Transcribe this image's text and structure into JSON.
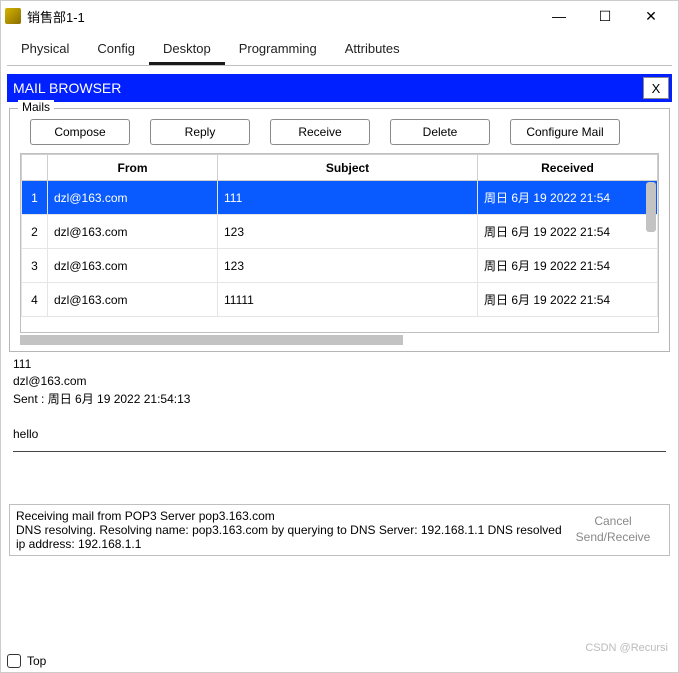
{
  "window": {
    "title": "销售部1-1"
  },
  "wincontrols": {
    "min": "—",
    "max": "☐",
    "close": "✕"
  },
  "tabs": [
    "Physical",
    "Config",
    "Desktop",
    "Programming",
    "Attributes"
  ],
  "active_tab_index": 2,
  "mailbrowser": {
    "title": "MAIL BROWSER",
    "close": "X"
  },
  "mails_label": "Mails",
  "buttons": {
    "compose": "Compose",
    "reply": "Reply",
    "receive": "Receive",
    "delete": "Delete",
    "configure": "Configure Mail"
  },
  "columns": {
    "from": "From",
    "subject": "Subject",
    "received": "Received"
  },
  "rows": [
    {
      "n": "1",
      "from": "dzl@163.com",
      "subject": "111",
      "received": "周日 6月 19 2022 21:54",
      "selected": true
    },
    {
      "n": "2",
      "from": "dzl@163.com",
      "subject": "123",
      "received": "周日 6月 19 2022 21:54"
    },
    {
      "n": "3",
      "from": "dzl@163.com",
      "subject": "123",
      "received": "周日 6月 19 2022 21:54"
    },
    {
      "n": "4",
      "from": "dzl@163.com",
      "subject": "11111",
      "received": "周日 6月 19 2022 21:54"
    }
  ],
  "preview": {
    "subject": "111",
    "from": "dzl@163.com",
    "sent_line": "Sent : 周日 6月 19 2022 21:54:13",
    "body": "hello"
  },
  "status": {
    "line1": "Receiving mail from POP3 Server pop3.163.com",
    "line2": "DNS resolving. Resolving name: pop3.163.com by querying to DNS Server: 192.168.1.1  DNS resolved ip address: 192.168.1.1"
  },
  "right_buttons": {
    "cancel": "Cancel",
    "sendrecv": "Send/Receive"
  },
  "footer": {
    "top_label": "Top"
  },
  "watermark": "CSDN @Recursi"
}
